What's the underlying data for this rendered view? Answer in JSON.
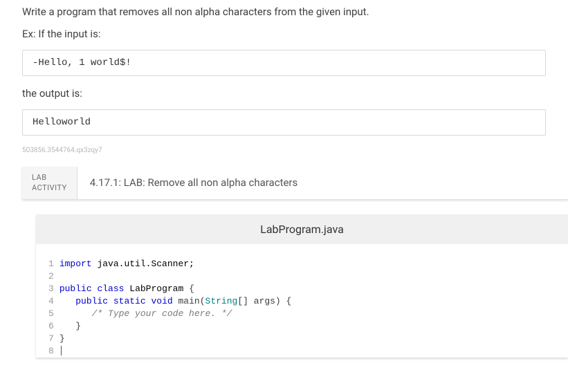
{
  "problem": {
    "line1": "Write a program that removes all non alpha characters from the given input.",
    "line2": "Ex: If the input is:",
    "sample_input": "-Hello, 1 world$!",
    "line3": "the output is:",
    "sample_output": "Helloworld"
  },
  "trace_id": "503856.3544764.qx3zqy7",
  "lab": {
    "tab_line1": "LAB",
    "tab_line2": "ACTIVITY",
    "title": "4.17.1: LAB: Remove all non alpha characters"
  },
  "editor": {
    "filename": "LabProgram.java",
    "line_numbers": [
      "1",
      "2",
      "3",
      "4",
      "5",
      "6",
      "7",
      "8"
    ],
    "code": {
      "l1": {
        "kw_import": "import",
        "pkg": "java.util.Scanner;"
      },
      "l2": "",
      "l3": {
        "kw_public": "public",
        "kw_class": "class",
        "name": "LabProgram",
        "brace": "{"
      },
      "l4": {
        "indent": "   ",
        "kw_public": "public",
        "kw_static": "static",
        "kw_void": "void",
        "main": "main(",
        "type": "String",
        "args": "[] args) {"
      },
      "l5": {
        "indent": "      ",
        "cmt": "/* Type your code here. */"
      },
      "l6": {
        "indent": "   ",
        "brace": "}"
      },
      "l7": {
        "brace": "}"
      },
      "l8": ""
    }
  }
}
